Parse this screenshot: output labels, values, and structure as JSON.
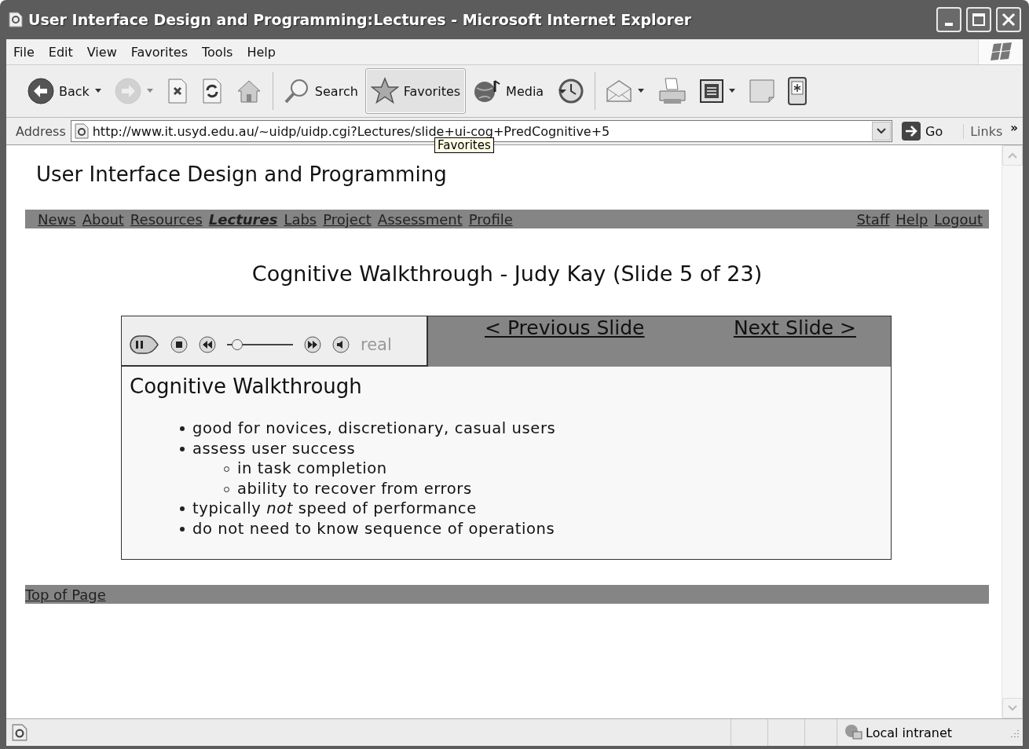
{
  "window": {
    "title": "User Interface Design and Programming:Lectures - Microsoft Internet Explorer"
  },
  "menu": [
    {
      "label": "File"
    },
    {
      "label": "Edit"
    },
    {
      "label": "View"
    },
    {
      "label": "Favorites"
    },
    {
      "label": "Tools"
    },
    {
      "label": "Help"
    }
  ],
  "toolbar": [
    {
      "kind": "back",
      "label": "Back",
      "dropdown": true,
      "disabled": false,
      "selected": false
    },
    {
      "kind": "forward",
      "dropdown": true,
      "disabled": true,
      "selected": false
    },
    {
      "kind": "stop",
      "dropdown": false,
      "disabled": false,
      "selected": false
    },
    {
      "kind": "refresh",
      "dropdown": false,
      "disabled": false,
      "selected": false
    },
    {
      "kind": "home",
      "dropdown": false,
      "disabled": false,
      "selected": false
    },
    {
      "kind": "search",
      "label": "Search",
      "dropdown": false,
      "disabled": false,
      "selected": false
    },
    {
      "kind": "favorites",
      "label": "Favorites",
      "dropdown": false,
      "disabled": false,
      "selected": true
    },
    {
      "kind": "media",
      "label": "Media",
      "dropdown": false,
      "disabled": false,
      "selected": false
    },
    {
      "kind": "history",
      "dropdown": false,
      "disabled": false,
      "selected": false
    },
    {
      "kind": "mail",
      "dropdown": true,
      "disabled": false,
      "selected": false
    },
    {
      "kind": "print",
      "dropdown": false,
      "disabled": false,
      "selected": false
    },
    {
      "kind": "edit",
      "dropdown": true,
      "disabled": false,
      "selected": false
    },
    {
      "kind": "note",
      "dropdown": false,
      "disabled": false,
      "selected": false
    },
    {
      "kind": "phone",
      "dropdown": false,
      "disabled": false,
      "selected": false
    }
  ],
  "address": {
    "label": "Address",
    "url": "http://www.it.usyd.edu.au/~uidp/uidp.cgi?Lectures/slide+ui-cog+PredCognitive+5",
    "go": "Go",
    "links": "Links",
    "more": "»"
  },
  "tooltip": {
    "text": "Favorites"
  },
  "page": {
    "heading": "User Interface Design and Programming",
    "nav_left": [
      {
        "label": "News",
        "current": false
      },
      {
        "label": "About",
        "current": false
      },
      {
        "label": "Resources",
        "current": false
      },
      {
        "label": "Lectures",
        "current": true
      },
      {
        "label": "Labs",
        "current": false
      },
      {
        "label": "Project",
        "current": false
      },
      {
        "label": "Assessment",
        "current": false
      },
      {
        "label": "Profile",
        "current": false
      }
    ],
    "nav_right": [
      {
        "label": "Staff"
      },
      {
        "label": "Help"
      },
      {
        "label": "Logout"
      }
    ],
    "slide_title": "Cognitive Walkthrough - Judy Kay (Slide 5 of 23)",
    "player": {
      "brand": "real",
      "level": 0.15
    },
    "slide_nav": {
      "previous": "< Previous Slide",
      "next": "Next Slide >"
    },
    "slide": {
      "title": "Cognitive Walkthrough",
      "bullets": [
        {
          "text": "good for novices, discretionary, casual users"
        },
        {
          "text": "assess user success",
          "children": [
            {
              "text": "in task completion"
            },
            {
              "text": "ability to recover from errors"
            }
          ]
        },
        {
          "text": "typically *not* speed of performance"
        },
        {
          "text": "do not need to know sequence of operations"
        }
      ]
    },
    "footer_link": "Top of Page"
  },
  "status_bar": {
    "zone": "Local intranet"
  }
}
